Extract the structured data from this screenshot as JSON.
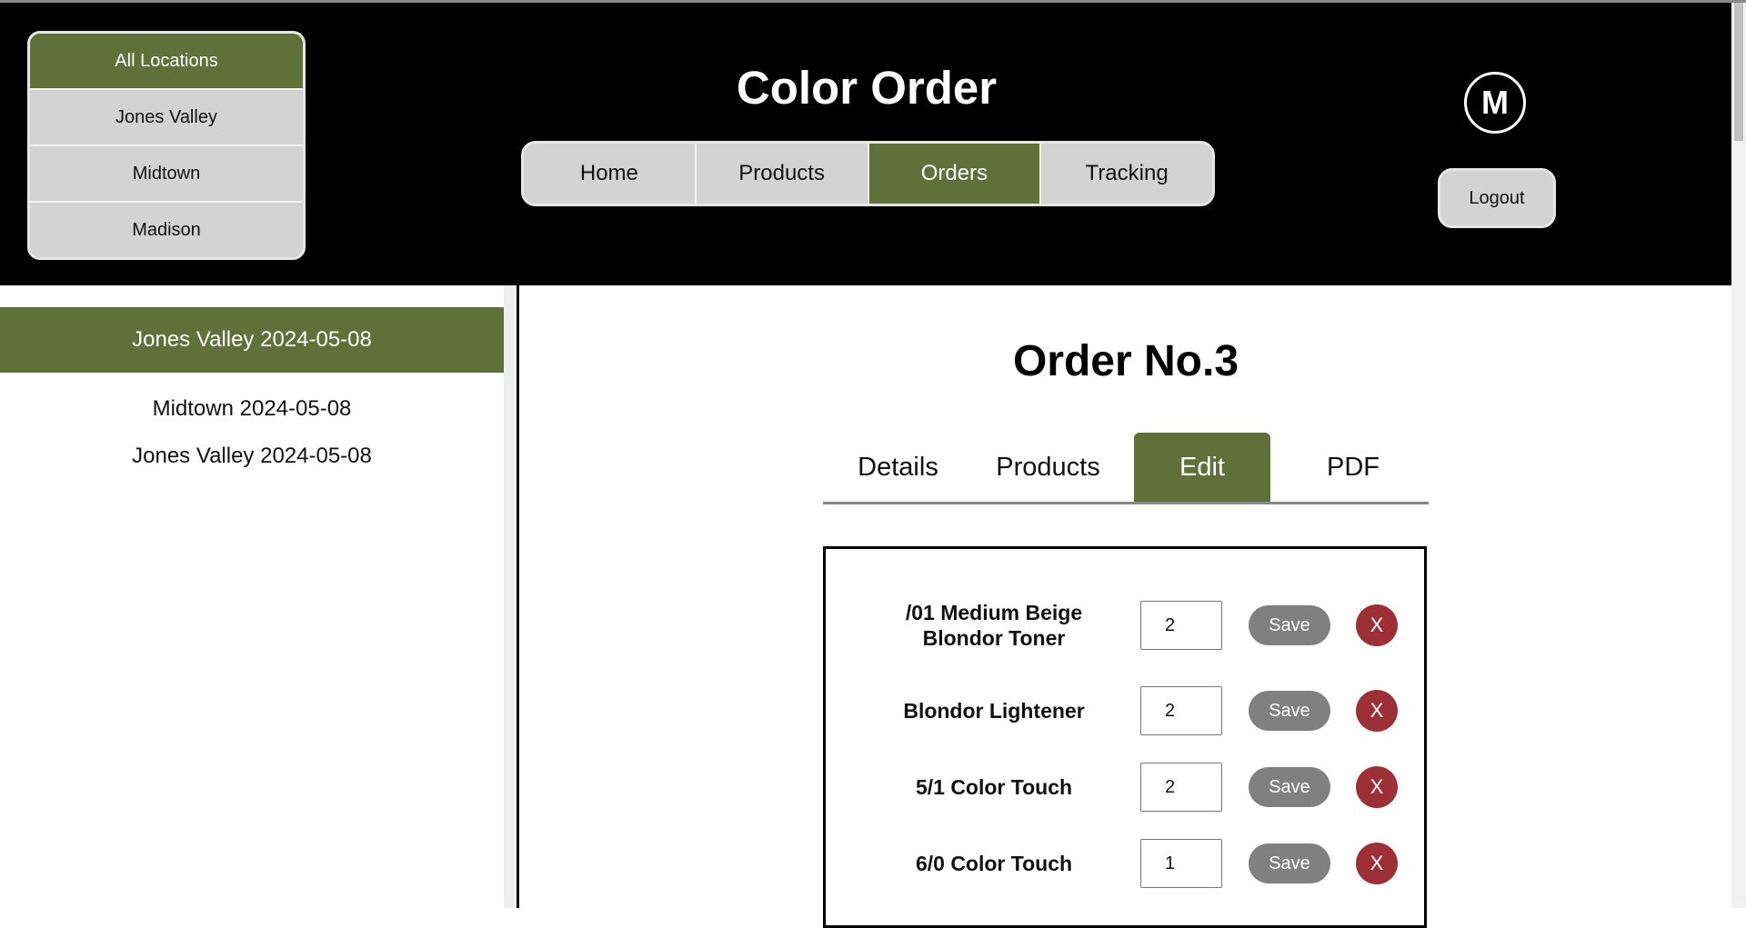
{
  "app": {
    "title": "Color Order"
  },
  "locations": [
    "All Locations",
    "Jones Valley",
    "Midtown",
    "Madison"
  ],
  "nav": [
    "Home",
    "Products",
    "Orders",
    "Tracking"
  ],
  "user": {
    "initial": "M",
    "logout_label": "Logout"
  },
  "sidebar": {
    "orders": [
      "Jones Valley 2024-05-08",
      "Midtown 2024-05-08",
      "Jones Valley 2024-05-08"
    ]
  },
  "order": {
    "title": "Order No.3",
    "tabs": [
      "Details",
      "Products",
      "Edit",
      "PDF"
    ],
    "items": [
      {
        "name": "/01 Medium Beige Blondor Toner",
        "qty": "2"
      },
      {
        "name": "Blondor Lightener",
        "qty": "2"
      },
      {
        "name": "5/1 Color Touch",
        "qty": "2"
      },
      {
        "name": "6/0 Color Touch",
        "qty": "1"
      }
    ],
    "save_label": "Save",
    "delete_label": "X"
  },
  "colors": {
    "accent": "#5f7139",
    "delete": "#9c3036",
    "save": "#808080"
  }
}
